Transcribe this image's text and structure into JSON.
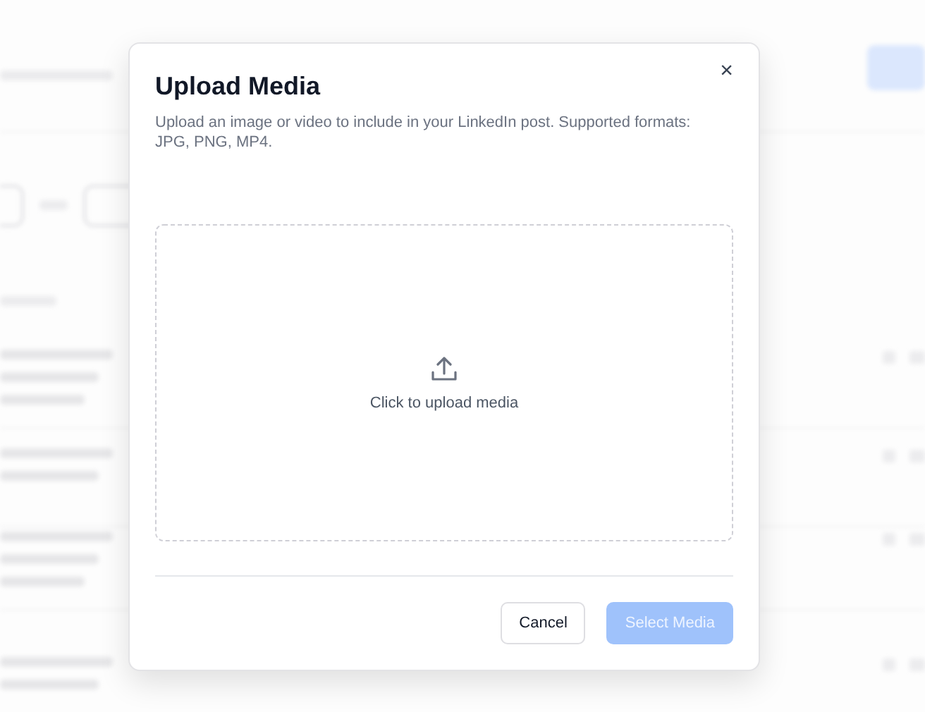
{
  "dialog": {
    "title": "Upload Media",
    "close_icon": "×",
    "description": "Upload an image or video to include in your LinkedIn post. Supported formats: JPG, PNG, MP4.",
    "dropzone": {
      "label": "Click to upload media"
    },
    "buttons": [
      {
        "label": "Cancel",
        "kind": "secondary",
        "disabled": false
      },
      {
        "label": "Select Media",
        "kind": "primary",
        "disabled": true
      }
    ]
  }
}
